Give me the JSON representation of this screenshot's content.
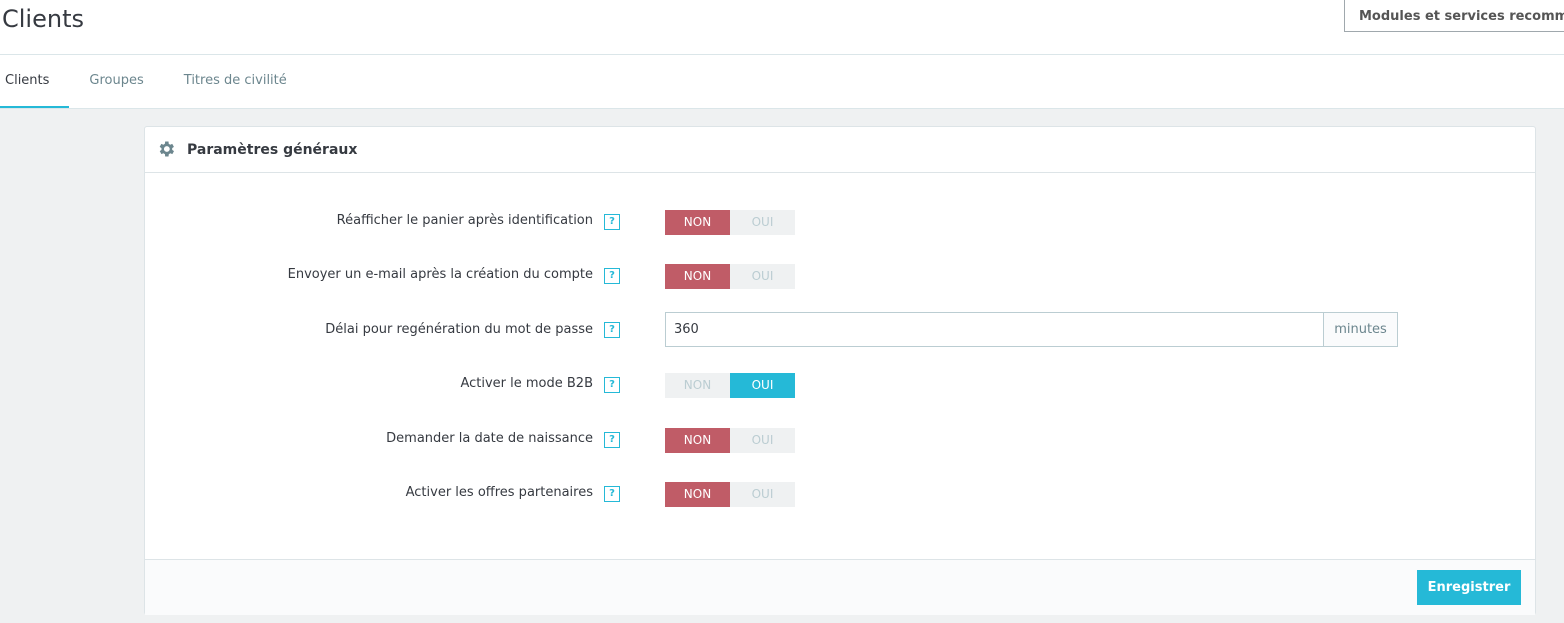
{
  "header": {
    "title": "Clients",
    "toolbar_button": "Modules et services recommandés"
  },
  "tabs": [
    {
      "label": "Clients",
      "active": true
    },
    {
      "label": "Groupes",
      "active": false
    },
    {
      "label": "Titres de civilité",
      "active": false
    }
  ],
  "panel": {
    "icon": "gear-icon",
    "title": "Paramètres généraux",
    "help_glyph": "?",
    "fields": [
      {
        "label": "Réafficher le panier après identification",
        "type": "switch",
        "no": "NON",
        "yes": "OUI",
        "value": "NON"
      },
      {
        "label": "Envoyer un e-mail après la création du compte",
        "type": "switch",
        "no": "NON",
        "yes": "OUI",
        "value": "NON"
      },
      {
        "label": "Délai pour regénération du mot de passe",
        "type": "text",
        "value": "360",
        "suffix": "minutes"
      },
      {
        "label": "Activer le mode B2B",
        "type": "switch",
        "no": "NON",
        "yes": "OUI",
        "value": "OUI"
      },
      {
        "label": "Demander la date de naissance",
        "type": "switch",
        "no": "NON",
        "yes": "OUI",
        "value": "NON"
      },
      {
        "label": "Activer les offres partenaires",
        "type": "switch",
        "no": "NON",
        "yes": "OUI",
        "value": "NON"
      }
    ],
    "save_label": "Enregistrer"
  },
  "colors": {
    "accent": "#25b9d7",
    "switch_no_active": "#c05c67",
    "switch_inactive": "#eff1f2",
    "background": "#eff1f2"
  }
}
